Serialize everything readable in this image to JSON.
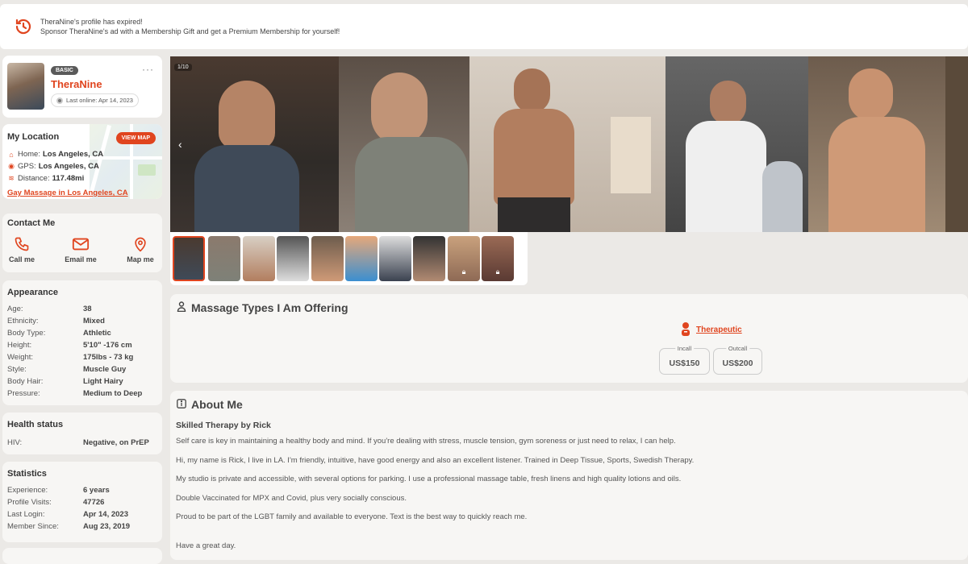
{
  "banner": {
    "line1": "TheraNine's profile has expired!",
    "line2": "Sponsor TheraNine's ad with a Membership Gift and get a Premium Membership for yourself!"
  },
  "profile": {
    "badge": "BASIC",
    "name": "TheraNine",
    "last_online": "Last online: Apr 14, 2023",
    "more": "···"
  },
  "location": {
    "title": "My Location",
    "view_map": "VIEW MAP",
    "home_label": "Home:",
    "home_value": "Los Angeles, CA",
    "gps_label": "GPS:",
    "gps_value": "Los Angeles, CA",
    "distance_label": "Distance:",
    "distance_value": "117.48mi",
    "link": "Gay Massage in Los Angeles, CA"
  },
  "contact": {
    "title": "Contact Me",
    "call": "Call me",
    "email": "Email me",
    "map": "Map me"
  },
  "appearance": {
    "title": "Appearance",
    "rows": [
      {
        "k": "Age:",
        "v": "38"
      },
      {
        "k": "Ethnicity:",
        "v": "Mixed"
      },
      {
        "k": "Body Type:",
        "v": "Athletic"
      },
      {
        "k": "Height:",
        "v": "5'10\" -176 cm"
      },
      {
        "k": "Weight:",
        "v": "175lbs - 73 kg"
      },
      {
        "k": "Style:",
        "v": "Muscle Guy"
      },
      {
        "k": "Body Hair:",
        "v": "Light Hairy"
      },
      {
        "k": "Pressure:",
        "v": "Medium to Deep"
      }
    ]
  },
  "health": {
    "title": "Health status",
    "k": "HIV:",
    "v": "Negative, on PrEP"
  },
  "stats": {
    "title": "Statistics",
    "rows": [
      {
        "k": "Experience:",
        "v": "6 years"
      },
      {
        "k": "Profile Visits:",
        "v": "47726"
      },
      {
        "k": "Last Login:",
        "v": "Apr 14, 2023"
      },
      {
        "k": "Member Since:",
        "v": "Aug 23, 2019"
      }
    ]
  },
  "gallery": {
    "counter": "1/10",
    "prev": "‹"
  },
  "massage": {
    "title": "Massage Types I Am Offering",
    "type": "Therapeutic",
    "incall_label": "Incall",
    "incall_value": "US$150",
    "outcall_label": "Outcall",
    "outcall_value": "US$200"
  },
  "about": {
    "title": "About Me",
    "subtitle": "Skilled Therapy by Rick",
    "p1": "Self care is key in maintaining a healthy body and mind. If you're dealing with stress, muscle tension, gym soreness or just need to relax, I can help.",
    "p2": "Hi, my name is Rick, I live in LA. I'm friendly, intuitive, have good energy and also an excellent listener. Trained in Deep Tissue, Sports, Swedish Therapy.",
    "p3": "My studio is private and accessible, with several options for parking. I use a professional massage table, fresh linens and high quality lotions and oils.",
    "p4": "Double Vaccinated for MPX and Covid, plus very socially conscious.",
    "p5": "Proud to be part of the LGBT family and available to everyone. Text is the best way to quickly reach me.",
    "p6": "Have a great day."
  },
  "colors": {
    "accent": "#e0451f",
    "background": "#ebe9e6",
    "card": "#f7f6f4"
  }
}
